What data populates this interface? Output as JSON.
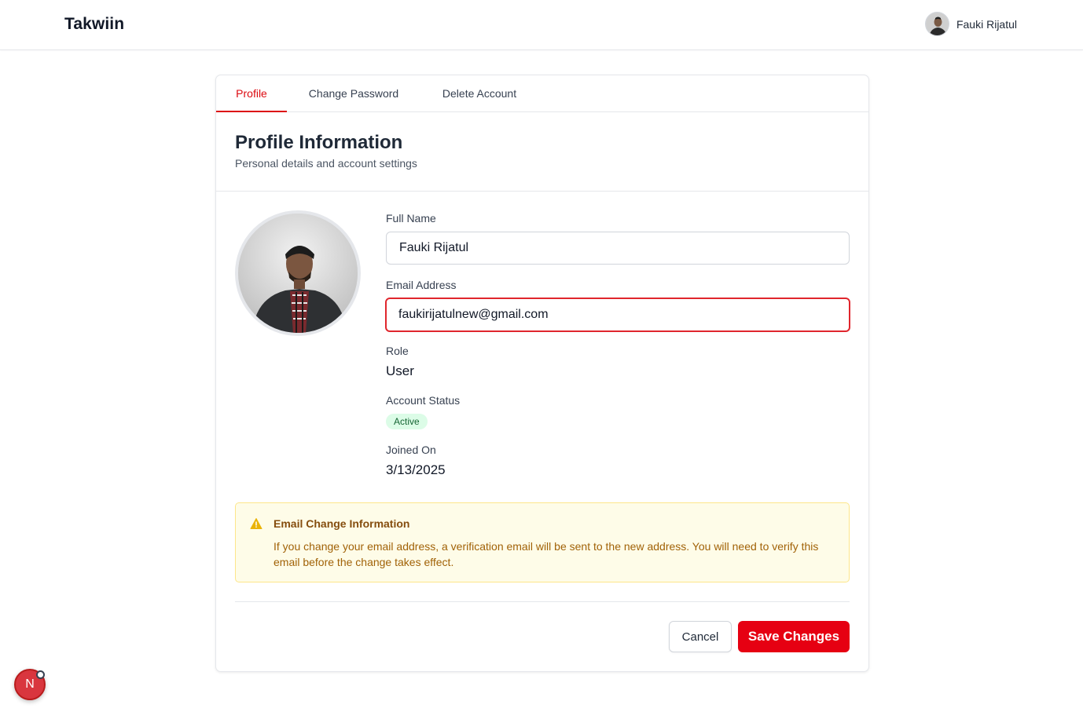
{
  "header": {
    "brand": "Takwiin",
    "user_name": "Fauki Rijatul"
  },
  "tabs": [
    {
      "label": "Profile",
      "active": true
    },
    {
      "label": "Change Password",
      "active": false
    },
    {
      "label": "Delete Account",
      "active": false
    }
  ],
  "section": {
    "title": "Profile Information",
    "subtitle": "Personal details and account settings"
  },
  "form": {
    "full_name_label": "Full Name",
    "full_name_value": "Fauki Rijatul",
    "email_label": "Email Address",
    "email_value": "faukirijatulnew@gmail.com",
    "role_label": "Role",
    "role_value": "User",
    "status_label": "Account Status",
    "status_value": "Active",
    "joined_label": "Joined On",
    "joined_value": "3/13/2025"
  },
  "notice": {
    "title": "Email Change Information",
    "text": "If you change your email address, a verification email will be sent to the new address. You will need to verify this email before the change takes effect."
  },
  "actions": {
    "cancel_label": "Cancel",
    "save_label": "Save Changes"
  },
  "dev_badge": {
    "letter": "N"
  },
  "colors": {
    "accent": "#e60012",
    "active_tab": "#dc0a10",
    "status_bg": "#dcfce7",
    "status_text": "#166534",
    "notice_bg": "#fefce8",
    "notice_border": "#fde68a",
    "notice_text": "#a16207",
    "warning_icon": "#eab308"
  }
}
